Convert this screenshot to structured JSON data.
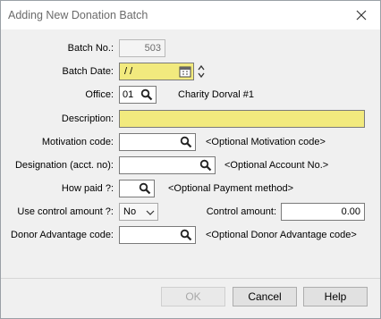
{
  "window": {
    "title": "Adding New Donation Batch"
  },
  "form": {
    "batch_no": {
      "label": "Batch No.:",
      "value": "503"
    },
    "batch_date": {
      "label": "Batch Date:",
      "value": " / /"
    },
    "office": {
      "label": "Office:",
      "value": "01",
      "name": "Charity Dorval #1"
    },
    "description": {
      "label": "Description:",
      "value": ""
    },
    "motivation_code": {
      "label": "Motivation code:",
      "value": "",
      "hint": "<Optional Motivation code>"
    },
    "designation": {
      "label": "Designation (acct. no):",
      "value": "",
      "hint": "<Optional Account No.>"
    },
    "how_paid": {
      "label": "How paid ?:",
      "value": "",
      "hint": "<Optional Payment method>"
    },
    "use_control_amount": {
      "label": "Use control amount ?:",
      "value": "No"
    },
    "control_amount": {
      "label": "Control amount:",
      "value": "0.00"
    },
    "donor_advantage_code": {
      "label": "Donor Advantage code:",
      "value": "",
      "hint": "<Optional Donor Advantage code>"
    }
  },
  "footer": {
    "ok_label": "OK",
    "cancel_label": "Cancel",
    "help_label": "Help"
  },
  "colors": {
    "required_field": "#f2ea7e",
    "window_bg": "#f0f0f0"
  },
  "icons": [
    "close-icon",
    "search-icon",
    "calendar-icon",
    "spinner-up-icon",
    "spinner-down-icon",
    "chevron-down-icon"
  ]
}
